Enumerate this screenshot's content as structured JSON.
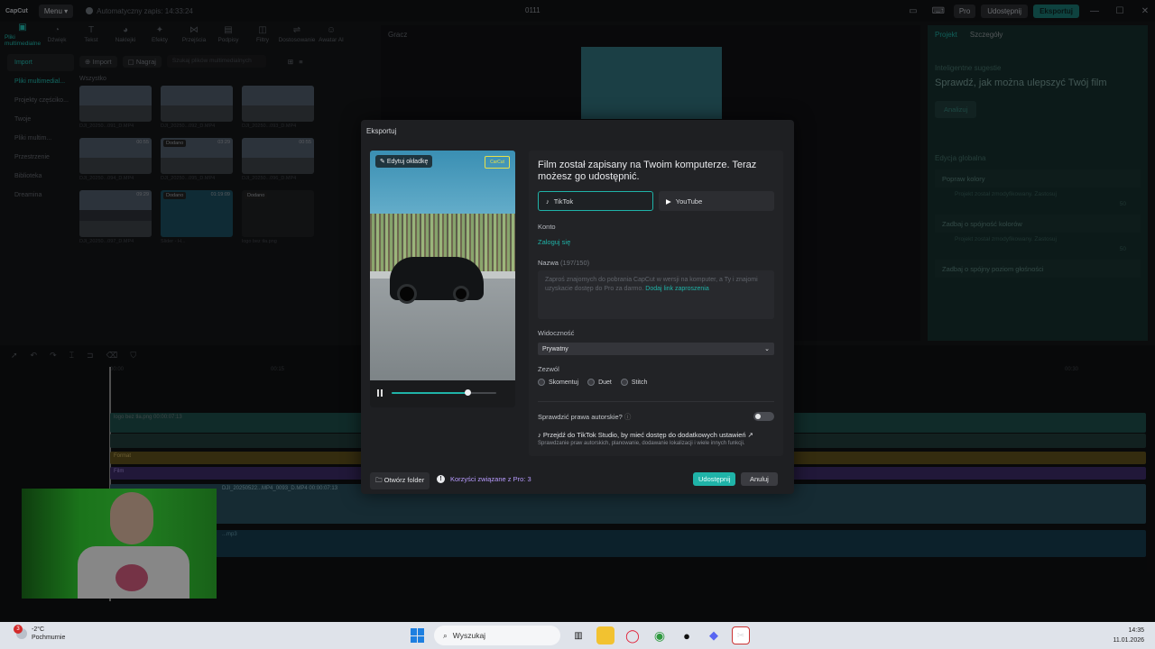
{
  "app": {
    "logo": "CapCut",
    "menu": "Menu",
    "autosave": "Automatyczny zapis: 14:33:24",
    "project_name": "0111",
    "pro": "Pro",
    "share": "Udostępnij",
    "export": "Eksportuj"
  },
  "toolbar": [
    {
      "label": "Pliki multimedialne",
      "icon": "media-icon"
    },
    {
      "label": "Dźwięk",
      "icon": "audio-icon"
    },
    {
      "label": "Tekst",
      "icon": "text-icon"
    },
    {
      "label": "Naklejki",
      "icon": "sticker-icon"
    },
    {
      "label": "Efekty",
      "icon": "effects-icon"
    },
    {
      "label": "Przejścia",
      "icon": "transitions-icon"
    },
    {
      "label": "Podpisy",
      "icon": "captions-icon"
    },
    {
      "label": "Filtry",
      "icon": "filters-icon"
    },
    {
      "label": "Dostosowanie",
      "icon": "adjust-icon"
    },
    {
      "label": "Awatar AI",
      "icon": "avatar-icon"
    }
  ],
  "sidebar": [
    "Import",
    "Pliki multimedial...",
    "Projekty częściko...",
    "Twoje",
    "Pliki multim...",
    "Przestrzenie",
    "Biblioteka",
    "Dreamina"
  ],
  "media": {
    "import": "Import",
    "record": "Nagraj",
    "search_placeholder": "Szukaj plików multimedialnych",
    "all": "Wszystko",
    "clips": [
      {
        "name": "DJI_20250...091_D.MP4",
        "badge": "",
        "dur": ""
      },
      {
        "name": "DJI_20250...092_D.MP4",
        "badge": "",
        "dur": ""
      },
      {
        "name": "DJI_20250...093_D.MP4",
        "badge": "",
        "dur": ""
      },
      {
        "name": "DJI_20250...094_D.MP4",
        "badge": "",
        "dur": "00:55"
      },
      {
        "name": "DJI_20250...095_D.MP4",
        "badge": "Dodano",
        "dur": "03:29"
      },
      {
        "name": "DJI_20250...096_D.MP4",
        "badge": "",
        "dur": "00:55"
      },
      {
        "name": "DJI_20250...097_D.MP4",
        "badge": "",
        "dur": "09:29"
      },
      {
        "name": "Slider - H...",
        "badge": "Dodano",
        "dur": "01:19:09"
      },
      {
        "name": "logo bez tła.png",
        "badge": "Dodano",
        "dur": ""
      }
    ]
  },
  "player": {
    "label": "Gracz"
  },
  "right_panel": {
    "tab_project": "Projekt",
    "tab_details": "Szczegóły",
    "heading": "Inteligentne sugestie",
    "title": "Sprawdź, jak można ulepszyć Twój film",
    "analyze": "Analizuj",
    "global_edit": "Edycja globalna",
    "rows": [
      "Popraw kolory",
      "Zadbaj o spójność kolorów",
      "Zadbaj o spójny poziom głośności"
    ],
    "applied": "Projekt został zmodyfikowany. Zastosuj",
    "value": "50"
  },
  "timeline": {
    "ruler": [
      "00:00",
      "00:15",
      "00:30"
    ],
    "track_logo": "logo bez tła.png  00:00:07:13",
    "track_format": "Format",
    "track_film": "Film",
    "track_clip": "DJI_20250522...MP4_0093_D.MP4  00:00:07:13",
    "track_audio": "...mp3"
  },
  "dialog": {
    "title": "Eksportuj",
    "edit_cover": "Edytuj okładkę",
    "preview_logo": "CarCut",
    "progress": 0.72,
    "headline": "Film został zapisany na Twoim komputerze. Teraz możesz go udostępnić.",
    "tiktok": "TikTok",
    "youtube": "YouTube",
    "account_label": "Konto",
    "login": "Zaloguj się",
    "name_label": "Nazwa",
    "name_count": "(197/150)",
    "description": "Zaproś znajomych do pobrania CapCut w wersji na komputer, a Ty i znajomi uzyskacie dostęp do Pro za darmo.",
    "invite_link": "Dodaj link zaproszenia",
    "visibility_label": "Widoczność",
    "visibility_value": "Prywatny",
    "allow_label": "Zezwól",
    "allow_options": [
      "Skomentuj",
      "Duet",
      "Stitch"
    ],
    "copyright": "Sprawdzić prawa autorskie?",
    "studio": "Przejdź do TikTok Studio, by mieć dostęp do dodatkowych ustawień",
    "studio_sub": "Sprawdzanie praw autorskich, planowanie, dodawanie lokalizacji i wiele innych funkcji.",
    "open_folder": "Otwórz folder",
    "pro_benefits": "Korzyści związane z Pro: 3",
    "share": "Udostępnij",
    "cancel": "Anuluj"
  },
  "taskbar": {
    "temp": "-2°C",
    "weather": "Pochmurnie",
    "notif": "3",
    "search": "Wyszukaj",
    "time": "14:35",
    "date": "11.01.2026"
  },
  "colors": {
    "accent": "#1fb3a8",
    "pro_purple": "#b89bff"
  }
}
